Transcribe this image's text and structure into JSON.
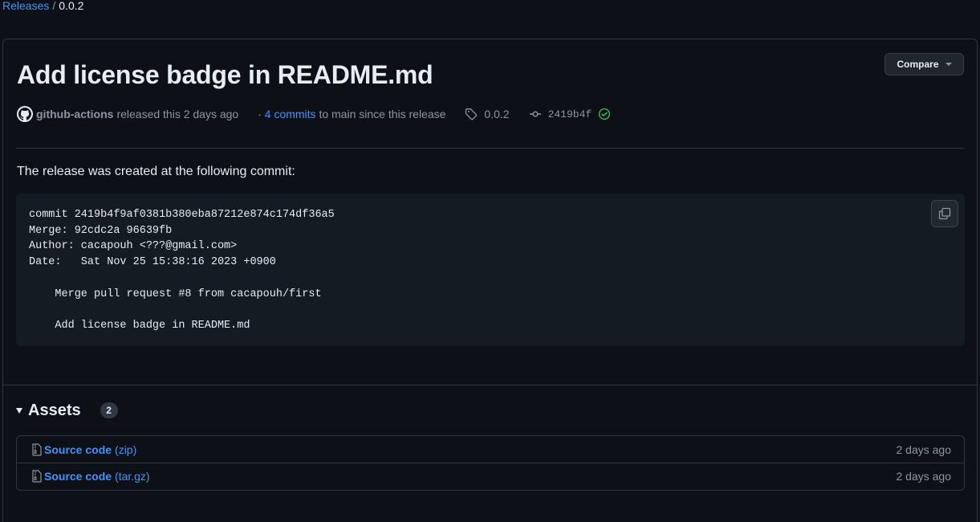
{
  "breadcrumb": {
    "parent": "Releases",
    "separator": "/",
    "current": "0.0.2"
  },
  "release": {
    "title": "Add license badge in README.md",
    "compare_label": "Compare",
    "author": "github-actions",
    "released_text": "released this 2 days ago",
    "commits_prefix": "·",
    "commits_link": "4 commits",
    "commits_suffix": "to main since this release",
    "tag": "0.0.2",
    "commit_sha": "2419b4f",
    "description": "The release was created at the following commit:",
    "code": "commit 2419b4f9af0381b380eba87212e874c174df36a5\nMerge: 92cdc2a 96639fb\nAuthor: cacapouh <???@gmail.com>\nDate:   Sat Nov 25 15:38:16 2023 +0900\n\n    Merge pull request #8 from cacapouh/first\n\n    Add license badge in README.md"
  },
  "assets": {
    "title": "Assets",
    "count": "2",
    "items": [
      {
        "name": "Source code",
        "ext": "(zip)",
        "date": "2 days ago"
      },
      {
        "name": "Source code",
        "ext": "(tar.gz)",
        "date": "2 days ago"
      }
    ]
  },
  "colors": {
    "background": "#0d1117",
    "link": "#4493f8",
    "muted": "#8d96a0",
    "border": "#30363d",
    "success": "#3fb950"
  },
  "icons": [
    "github-icon",
    "tag-icon",
    "git-commit-icon",
    "check-circle-icon",
    "copy-icon",
    "file-zip-icon"
  ]
}
